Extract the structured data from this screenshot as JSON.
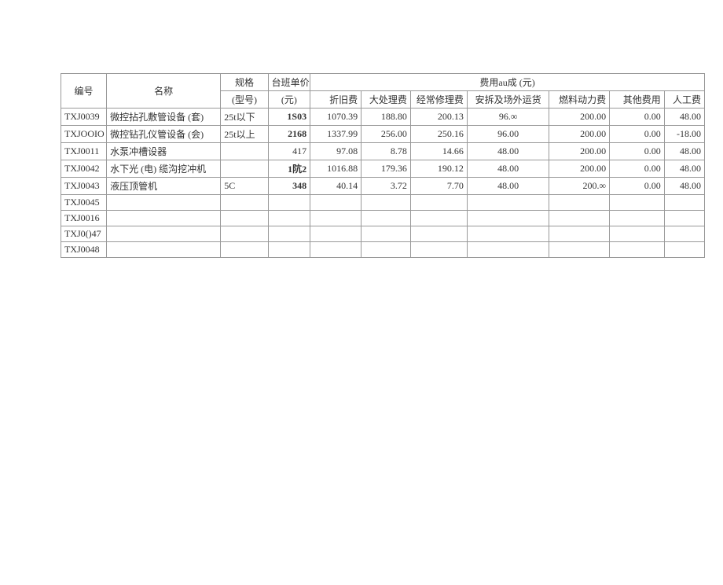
{
  "headers": {
    "id": "编号",
    "name": "名称",
    "spec": "规格",
    "spec_sub": "(型号)",
    "unit_price": "台班单价",
    "unit_price_sub": "(元)",
    "cost_group": "费用au成 (元)",
    "c1": "折旧费",
    "c2": "大处理费",
    "c3": "经常修理费",
    "c4": "安拆及场外运货",
    "c5": "燃料动力费",
    "c6": "其他费用",
    "c7": "人工费"
  },
  "rows": [
    {
      "id": "TXJ0039",
      "name": "微控拈孔敷管设备 (套)",
      "spec": "25t以下",
      "unit_price": "1S03",
      "c1": "1070.39",
      "c2": "188.80",
      "c3": "200.13",
      "c4": "96.∞",
      "c5": "200.00",
      "c6": "0.00",
      "c7": "48.00"
    },
    {
      "id": "TXJOOIO",
      "name": "微控钻孔仪管设备 (会)",
      "spec": "25t以上",
      "unit_price": "2168",
      "c1": "1337.99",
      "c2": "256.00",
      "c3": "250.16",
      "c4": "96.00",
      "c5": "200.00",
      "c6": "0.00",
      "c7": "-18.00"
    },
    {
      "id": "TXJ0011",
      "name": "水泵冲槽设器",
      "spec": "",
      "unit_price": "417",
      "c1": "97.08",
      "c2": "8.78",
      "c3": "14.66",
      "c4": "48.00",
      "c5": "200.00",
      "c6": "0.00",
      "c7": "48.00"
    },
    {
      "id": "TXJ0042",
      "name": "水下光 (电) 缆沟挖冲机",
      "spec": "",
      "unit_price": "1阬2",
      "c1": "1016.88",
      "c2": "179.36",
      "c3": "190.12",
      "c4": "48.00",
      "c5": "200.00",
      "c6": "0.00",
      "c7": "48.00"
    },
    {
      "id": "TXJ0043",
      "name": "液压顶管机",
      "spec": "5C",
      "unit_price": "348",
      "c1": "40.14",
      "c2": "3.72",
      "c3": "7.70",
      "c4": "48.00",
      "c5": "200.∞",
      "c6": "0.00",
      "c7": "48.00"
    },
    {
      "id": "TXJ0045",
      "name": "",
      "spec": "",
      "unit_price": "",
      "c1": "",
      "c2": "",
      "c3": "",
      "c4": "",
      "c5": "",
      "c6": "",
      "c7": ""
    },
    {
      "id": "TXJ0016",
      "name": "",
      "spec": "",
      "unit_price": "",
      "c1": "",
      "c2": "",
      "c3": "",
      "c4": "",
      "c5": "",
      "c6": "",
      "c7": ""
    },
    {
      "id": "TXJ0()47",
      "name": "",
      "spec": "",
      "unit_price": "",
      "c1": "",
      "c2": "",
      "c3": "",
      "c4": "",
      "c5": "",
      "c6": "",
      "c7": ""
    },
    {
      "id": "TXJ0048",
      "name": "",
      "spec": "",
      "unit_price": "",
      "c1": "",
      "c2": "",
      "c3": "",
      "c4": "",
      "c5": "",
      "c6": "",
      "c7": ""
    }
  ]
}
